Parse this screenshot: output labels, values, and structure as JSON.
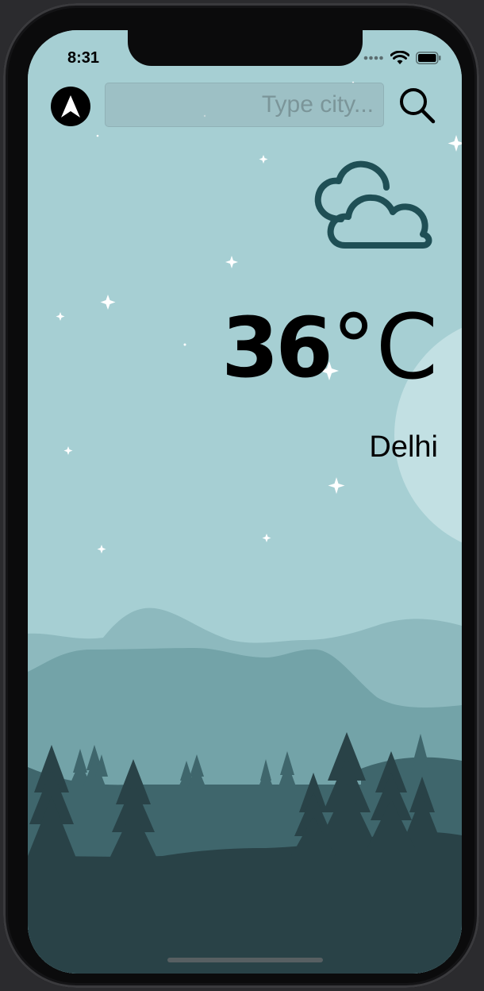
{
  "status_bar": {
    "time": "8:31",
    "signal_icon": "signal-dots-icon",
    "wifi_icon": "wifi-icon",
    "battery_icon": "battery-icon"
  },
  "search": {
    "placeholder": "Type city...",
    "value": "",
    "location_icon": "navigation-arrow-icon",
    "search_icon": "magnifier-icon"
  },
  "weather": {
    "condition_icon": "clouds-icon",
    "temperature": "36",
    "unit": "°C",
    "city": "Delhi"
  },
  "colors": {
    "sky": "#a6cfd3",
    "moon": "#c2e0e3",
    "hill_far": "#8db9be",
    "hill_mid": "#73a3a8",
    "ground_mid": "#3f666c",
    "ground_dark": "#294247",
    "icon_dark": "#1f4f55",
    "text": "#000000"
  }
}
